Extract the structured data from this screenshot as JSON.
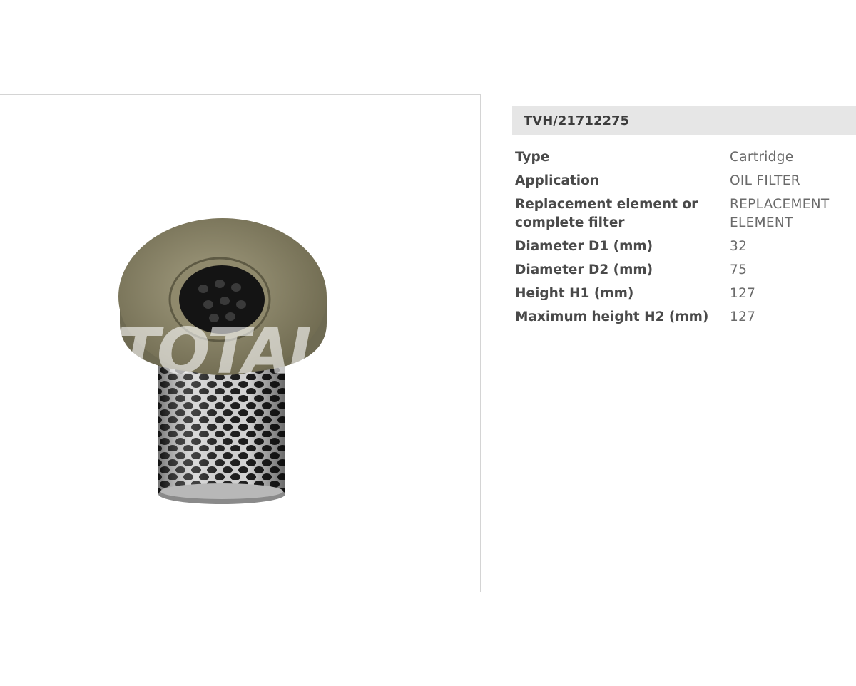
{
  "product": {
    "sku": "TVH/21712275",
    "image_alt": "oil filter cartridge"
  },
  "specs": [
    {
      "label": "Type",
      "value": "Cartridge"
    },
    {
      "label": "Application",
      "value": "OIL FILTER"
    },
    {
      "label": "Replacement element or complete filter",
      "value": "REPLACEMENT ELEMENT"
    },
    {
      "label": "Diameter D1 (mm)",
      "value": "32"
    },
    {
      "label": "Diameter D2 (mm)",
      "value": "75"
    },
    {
      "label": "Height H1 (mm)",
      "value": "127"
    },
    {
      "label": "Maximum height H2 (mm)",
      "value": "127"
    }
  ],
  "watermark": {
    "text": "TOTAL"
  },
  "colors": {
    "sku_bar": "#e6e6e6",
    "flange": "#8c8668",
    "mesh": "#c8c8c8"
  }
}
